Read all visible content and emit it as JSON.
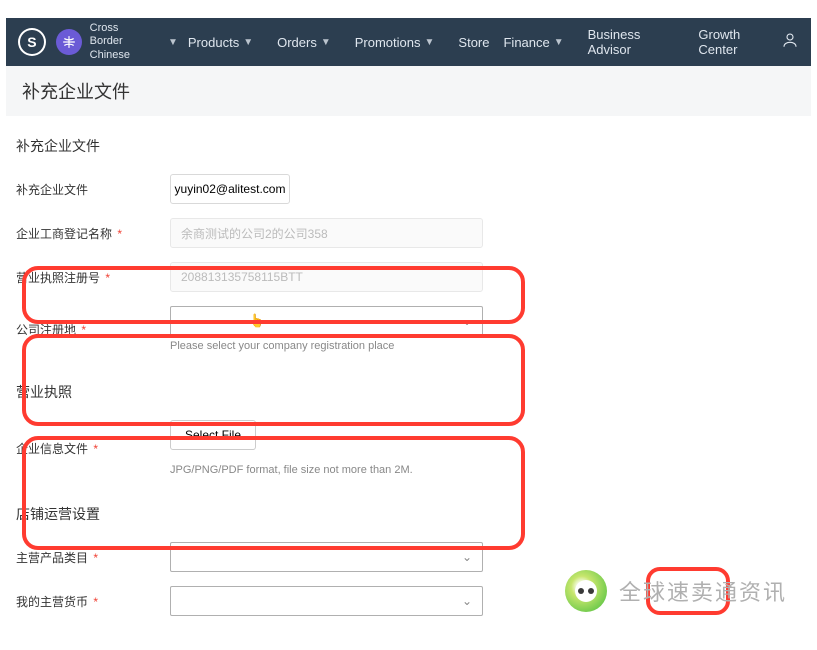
{
  "header": {
    "langLine1": "Cross Border",
    "langLine2": "Chinese",
    "nav": {
      "products": "Products",
      "orders": "Orders",
      "promotions": "Promotions",
      "store": "Store",
      "finance": "Finance",
      "advisor": "Business Advisor",
      "growth": "Growth Center"
    }
  },
  "page": {
    "title": "补充企业文件"
  },
  "section1": {
    "title": "补充企业文件",
    "r1": {
      "label": "补充企业文件",
      "value": "yuyin02@alitest.com"
    },
    "r2": {
      "label": "企业工商登记名称",
      "placeholder": "余商测试的公司2的公司358"
    },
    "r3": {
      "label": "营业执照注册号",
      "placeholder": "208813135758115BTT"
    },
    "r4": {
      "label": "公司注册地",
      "hint": "Please select your company registration place"
    }
  },
  "section2": {
    "title": "营业执照",
    "r1": {
      "label": "企业信息文件",
      "button": "Select File",
      "hint": "JPG/PNG/PDF format, file size not more than 2M."
    }
  },
  "section3": {
    "title": "店铺运营设置",
    "r1": {
      "label": "主营产品类目"
    },
    "r2": {
      "label": "我的主营货币"
    }
  },
  "watermark": "全球速卖通资讯"
}
